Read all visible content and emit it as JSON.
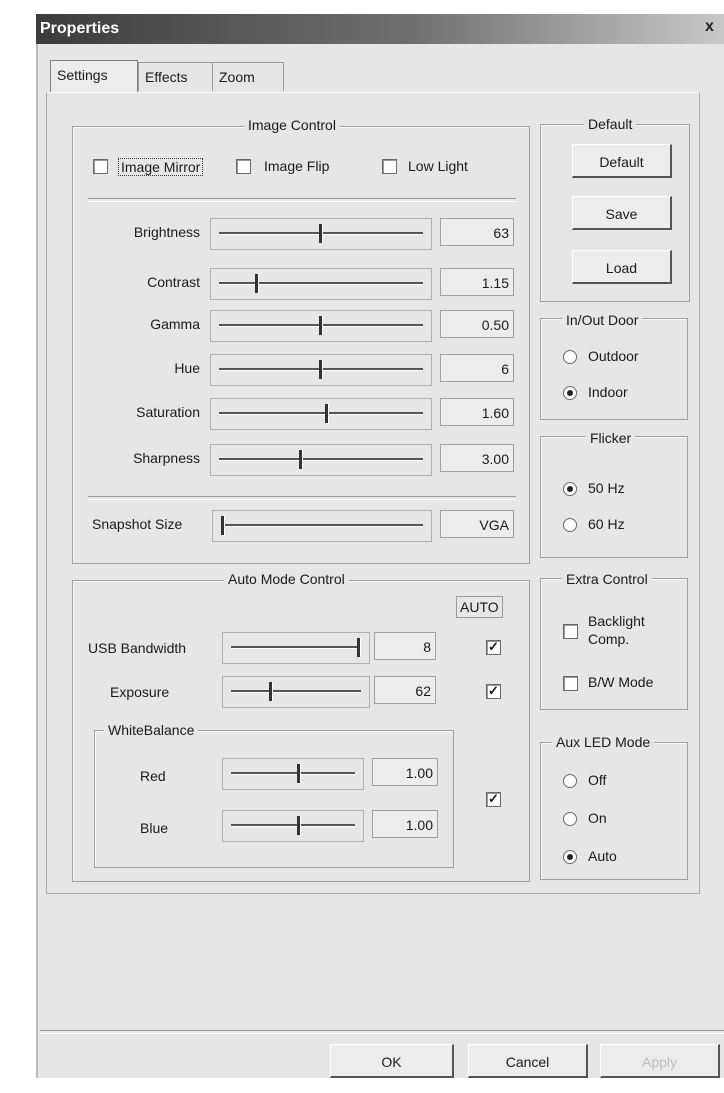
{
  "window": {
    "title": "Properties",
    "close": "x"
  },
  "tabs": [
    "Settings",
    "Effects",
    "Zoom"
  ],
  "image_control": {
    "legend": "Image Control",
    "checks": [
      {
        "label": "Image Mirror",
        "checked": false
      },
      {
        "label": "Image Flip",
        "checked": false
      },
      {
        "label": "Low Light",
        "checked": false
      }
    ],
    "sliders": [
      {
        "label": "Brightness",
        "value": "63",
        "level": 0.5
      },
      {
        "label": "Contrast",
        "value": "1.15",
        "level": 0.18
      },
      {
        "label": "Gamma",
        "value": "0.50",
        "level": 0.5
      },
      {
        "label": "Hue",
        "value": "6",
        "level": 0.5
      },
      {
        "label": "Saturation",
        "value": "1.60",
        "level": 0.53
      },
      {
        "label": "Sharpness",
        "value": "3.00",
        "level": 0.4
      }
    ],
    "snapshot": {
      "label": "Snapshot Size",
      "value": "VGA",
      "level": 0.0
    }
  },
  "default_group": {
    "legend": "Default",
    "buttons": [
      "Default",
      "Save",
      "Load"
    ]
  },
  "in_out_door": {
    "legend": "In/Out Door",
    "options": [
      {
        "label": "Outdoor",
        "selected": false
      },
      {
        "label": "Indoor",
        "selected": true
      }
    ]
  },
  "flicker": {
    "legend": "Flicker",
    "options": [
      {
        "label": "50 Hz",
        "selected": true
      },
      {
        "label": "60 Hz",
        "selected": false
      }
    ]
  },
  "extra_control": {
    "legend": "Extra Control",
    "checks": [
      {
        "label": "Backlight Comp.",
        "checked": false
      },
      {
        "label": "B/W Mode",
        "checked": false
      }
    ]
  },
  "aux_led": {
    "legend": "Aux LED Mode",
    "options": [
      {
        "label": "Off",
        "selected": false
      },
      {
        "label": "On",
        "selected": false
      },
      {
        "label": "Auto",
        "selected": true
      }
    ]
  },
  "auto_mode": {
    "legend": "Auto Mode Control",
    "auto_header": "AUTO",
    "usb": {
      "label": "USB Bandwidth",
      "value": "8",
      "level": 1.0,
      "auto": true
    },
    "exposure": {
      "label": "Exposure",
      "value": "62",
      "level": 0.3,
      "auto": true
    },
    "white_balance": {
      "legend": "WhiteBalance",
      "red": {
        "label": "Red",
        "value": "1.00",
        "level": 0.55
      },
      "blue": {
        "label": "Blue",
        "value": "1.00",
        "level": 0.55
      },
      "auto": true
    }
  },
  "footer": {
    "ok": "OK",
    "cancel": "Cancel",
    "apply": "Apply"
  }
}
